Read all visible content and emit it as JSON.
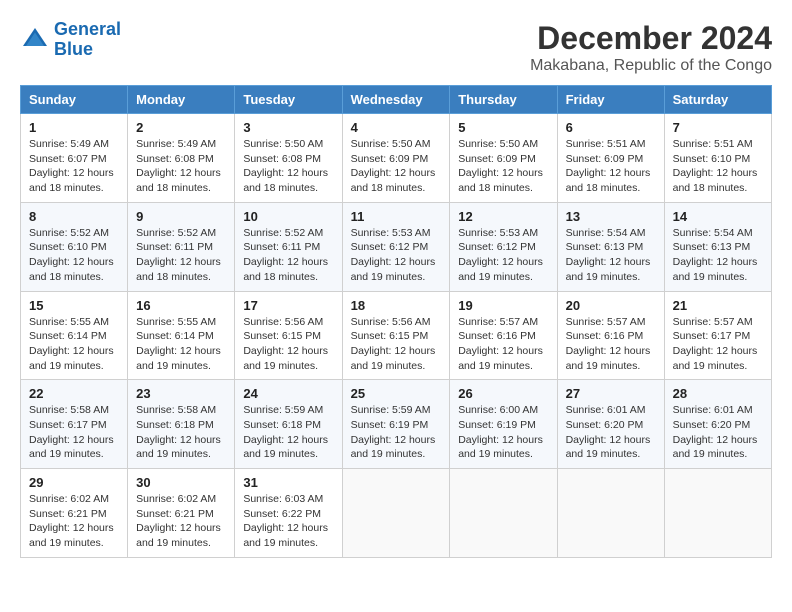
{
  "logo": {
    "line1": "General",
    "line2": "Blue"
  },
  "title": "December 2024",
  "subtitle": "Makabana, Republic of the Congo",
  "weekdays": [
    "Sunday",
    "Monday",
    "Tuesday",
    "Wednesday",
    "Thursday",
    "Friday",
    "Saturday"
  ],
  "weeks": [
    [
      {
        "day": "1",
        "info": "Sunrise: 5:49 AM\nSunset: 6:07 PM\nDaylight: 12 hours and 18 minutes."
      },
      {
        "day": "2",
        "info": "Sunrise: 5:49 AM\nSunset: 6:08 PM\nDaylight: 12 hours and 18 minutes."
      },
      {
        "day": "3",
        "info": "Sunrise: 5:50 AM\nSunset: 6:08 PM\nDaylight: 12 hours and 18 minutes."
      },
      {
        "day": "4",
        "info": "Sunrise: 5:50 AM\nSunset: 6:09 PM\nDaylight: 12 hours and 18 minutes."
      },
      {
        "day": "5",
        "info": "Sunrise: 5:50 AM\nSunset: 6:09 PM\nDaylight: 12 hours and 18 minutes."
      },
      {
        "day": "6",
        "info": "Sunrise: 5:51 AM\nSunset: 6:09 PM\nDaylight: 12 hours and 18 minutes."
      },
      {
        "day": "7",
        "info": "Sunrise: 5:51 AM\nSunset: 6:10 PM\nDaylight: 12 hours and 18 minutes."
      }
    ],
    [
      {
        "day": "8",
        "info": "Sunrise: 5:52 AM\nSunset: 6:10 PM\nDaylight: 12 hours and 18 minutes."
      },
      {
        "day": "9",
        "info": "Sunrise: 5:52 AM\nSunset: 6:11 PM\nDaylight: 12 hours and 18 minutes."
      },
      {
        "day": "10",
        "info": "Sunrise: 5:52 AM\nSunset: 6:11 PM\nDaylight: 12 hours and 18 minutes."
      },
      {
        "day": "11",
        "info": "Sunrise: 5:53 AM\nSunset: 6:12 PM\nDaylight: 12 hours and 19 minutes."
      },
      {
        "day": "12",
        "info": "Sunrise: 5:53 AM\nSunset: 6:12 PM\nDaylight: 12 hours and 19 minutes."
      },
      {
        "day": "13",
        "info": "Sunrise: 5:54 AM\nSunset: 6:13 PM\nDaylight: 12 hours and 19 minutes."
      },
      {
        "day": "14",
        "info": "Sunrise: 5:54 AM\nSunset: 6:13 PM\nDaylight: 12 hours and 19 minutes."
      }
    ],
    [
      {
        "day": "15",
        "info": "Sunrise: 5:55 AM\nSunset: 6:14 PM\nDaylight: 12 hours and 19 minutes."
      },
      {
        "day": "16",
        "info": "Sunrise: 5:55 AM\nSunset: 6:14 PM\nDaylight: 12 hours and 19 minutes."
      },
      {
        "day": "17",
        "info": "Sunrise: 5:56 AM\nSunset: 6:15 PM\nDaylight: 12 hours and 19 minutes."
      },
      {
        "day": "18",
        "info": "Sunrise: 5:56 AM\nSunset: 6:15 PM\nDaylight: 12 hours and 19 minutes."
      },
      {
        "day": "19",
        "info": "Sunrise: 5:57 AM\nSunset: 6:16 PM\nDaylight: 12 hours and 19 minutes."
      },
      {
        "day": "20",
        "info": "Sunrise: 5:57 AM\nSunset: 6:16 PM\nDaylight: 12 hours and 19 minutes."
      },
      {
        "day": "21",
        "info": "Sunrise: 5:57 AM\nSunset: 6:17 PM\nDaylight: 12 hours and 19 minutes."
      }
    ],
    [
      {
        "day": "22",
        "info": "Sunrise: 5:58 AM\nSunset: 6:17 PM\nDaylight: 12 hours and 19 minutes."
      },
      {
        "day": "23",
        "info": "Sunrise: 5:58 AM\nSunset: 6:18 PM\nDaylight: 12 hours and 19 minutes."
      },
      {
        "day": "24",
        "info": "Sunrise: 5:59 AM\nSunset: 6:18 PM\nDaylight: 12 hours and 19 minutes."
      },
      {
        "day": "25",
        "info": "Sunrise: 5:59 AM\nSunset: 6:19 PM\nDaylight: 12 hours and 19 minutes."
      },
      {
        "day": "26",
        "info": "Sunrise: 6:00 AM\nSunset: 6:19 PM\nDaylight: 12 hours and 19 minutes."
      },
      {
        "day": "27",
        "info": "Sunrise: 6:01 AM\nSunset: 6:20 PM\nDaylight: 12 hours and 19 minutes."
      },
      {
        "day": "28",
        "info": "Sunrise: 6:01 AM\nSunset: 6:20 PM\nDaylight: 12 hours and 19 minutes."
      }
    ],
    [
      {
        "day": "29",
        "info": "Sunrise: 6:02 AM\nSunset: 6:21 PM\nDaylight: 12 hours and 19 minutes."
      },
      {
        "day": "30",
        "info": "Sunrise: 6:02 AM\nSunset: 6:21 PM\nDaylight: 12 hours and 19 minutes."
      },
      {
        "day": "31",
        "info": "Sunrise: 6:03 AM\nSunset: 6:22 PM\nDaylight: 12 hours and 19 minutes."
      },
      null,
      null,
      null,
      null
    ]
  ]
}
